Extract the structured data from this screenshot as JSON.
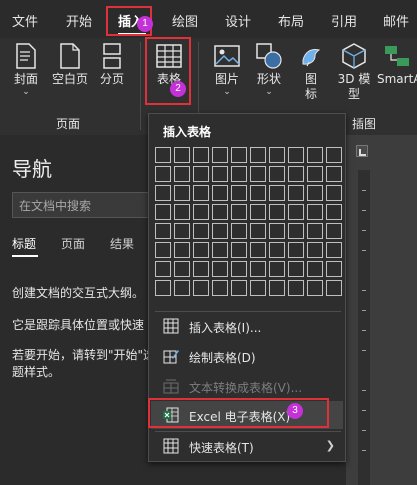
{
  "tabs": [
    "文件",
    "开始",
    "插入",
    "绘图",
    "设计",
    "布局",
    "引用",
    "邮件"
  ],
  "active_tab": "插入",
  "ribbon": {
    "pages_group": {
      "buttons": [
        "封面",
        "空白页",
        "分页"
      ],
      "label": "页面"
    },
    "table_button": "表格",
    "illustrations_group": {
      "buttons": [
        "图片",
        "形状",
        "图标",
        "3D 模型",
        "SmartA"
      ],
      "label": "插图"
    }
  },
  "nav": {
    "title": "导航",
    "search_placeholder": "在文档中搜索",
    "tabs": [
      "标题",
      "页面",
      "结果"
    ],
    "active_tab": "标题",
    "lines": [
      "创建文档的交互式大纲。",
      "它是跟踪具体位置或快速",
      "若要开始，请转到\"开始\"选",
      "题样式。"
    ]
  },
  "dropdown": {
    "title": "插入表格",
    "grid_cols": 10,
    "grid_rows": 8,
    "items": [
      {
        "label": "插入表格(I)...",
        "icon": "table-icon",
        "disabled": false
      },
      {
        "label": "绘制表格(D)",
        "icon": "draw-table-icon",
        "disabled": false
      },
      {
        "label": "文本转换成表格(V)...",
        "icon": "convert-text-icon",
        "disabled": true
      },
      {
        "label": "Excel 电子表格(X)",
        "icon": "excel-icon",
        "disabled": false
      },
      {
        "label": "快速表格(T)",
        "icon": "quick-table-icon",
        "disabled": false,
        "submenu": true
      }
    ]
  },
  "annotations": [
    "1",
    "2",
    "3"
  ],
  "colors": {
    "accent_red": "#e0303a",
    "badge": "#c531d8",
    "excel_green": "#1e7145"
  }
}
